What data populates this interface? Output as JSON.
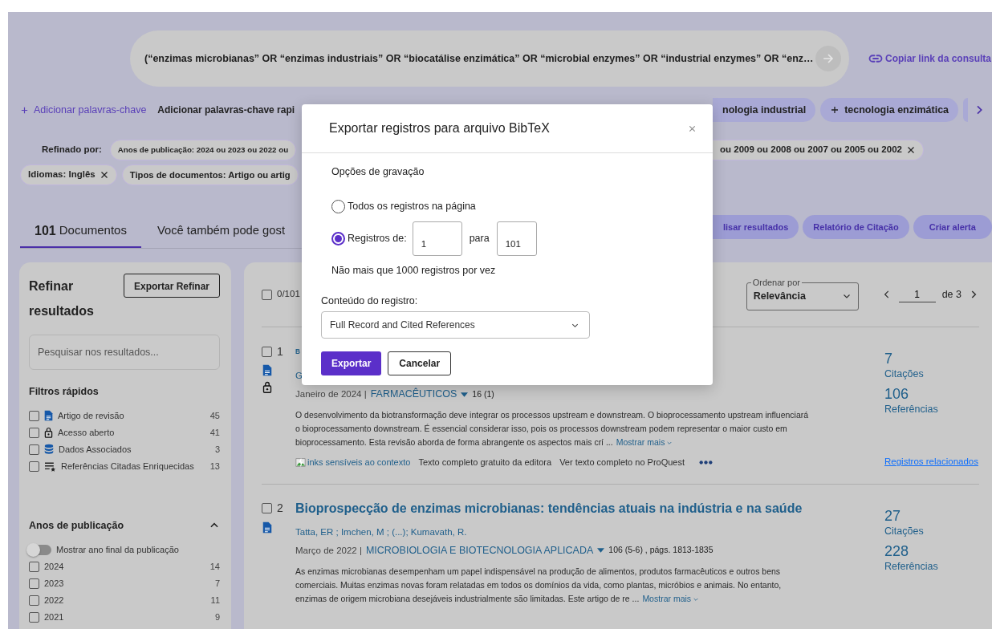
{
  "search": {
    "query": "(“enzimas microbianas” OR “enzimas industriais” OR “biocatálise enzimática” OR “microbial enzymes” OR “industrial enzymes” OR “enz…",
    "copy_link": "Copiar link da consulta"
  },
  "keywords": {
    "add": "Adicionar palavras-chave",
    "quick_label": "Adicionar palavras-chave rapi",
    "chips": [
      {
        "kind": "text",
        "label": "nologia industrial"
      },
      {
        "kind": "add",
        "label": "tecnologia enzimática"
      },
      {
        "kind": "stub"
      }
    ]
  },
  "refined_by": {
    "label": "Refinado por:",
    "rows": [
      {
        "left": [
          {
            "label": "Anos de publicação: 2024 ou 2023 ou 2022 ou",
            "removable": false
          }
        ],
        "right": [
          {
            "label": "ou 2009 ou 2008 ou 2007 ou 2005 ou 2002",
            "removable": true
          }
        ]
      },
      {
        "left": [
          {
            "label": "Idiomas: Inglês",
            "removable": true
          },
          {
            "label": "Tipos de documentos: Artigo ou artig",
            "removable": false
          }
        ]
      }
    ]
  },
  "tabs": [
    {
      "count": "101",
      "label": "Documentos",
      "selected": true
    },
    {
      "label": "Você também pode gost",
      "selected": false
    }
  ],
  "actions": [
    "lisar resultados",
    "Relatório de Citação",
    "Criar alerta"
  ],
  "refine": {
    "title": "Refinar resultados",
    "export": "Exportar Refinar",
    "search_placeholder": "Pesquisar nos resultados...",
    "quick_title": "Filtros rápidos",
    "quick_filters": [
      {
        "kind": "review",
        "label": "Artigo de revisão",
        "count": "45",
        "checked": false
      },
      {
        "kind": "open_access",
        "label": "Acesso aberto",
        "count": "41",
        "checked": false
      },
      {
        "kind": "data",
        "label": "Dados Associados",
        "count": "3",
        "checked": false
      },
      {
        "kind": "enriched",
        "label": "Referências Citadas Enriquecidas",
        "count": "13",
        "checked": false
      }
    ],
    "years_title": "Anos de publicação",
    "years_expanded": true,
    "toggle": {
      "label": "Mostrar ano final da publicação",
      "on": false
    },
    "years": [
      {
        "label": "2024",
        "count": "14",
        "checked": false
      },
      {
        "label": "2023",
        "count": "7",
        "checked": false
      },
      {
        "label": "2022",
        "count": "11",
        "checked": false
      },
      {
        "label": "2021",
        "count": "9",
        "checked": false
      }
    ]
  },
  "results": {
    "selected_count": "0/101",
    "all_checked": false,
    "sort": {
      "label": "Ordenar por",
      "value": "Relevância"
    },
    "page": {
      "current": "1",
      "of": "de 3"
    },
    "items": [
      {
        "number": "1",
        "checked": false,
        "title": "B",
        "open_access": true,
        "authors": "G",
        "date": "Janeiro de 2024 |",
        "journal": "FARMACÊUTICOS",
        "volume": "16 (1)",
        "abstract": "O desenvolvimento da biotransformação deve integrar os processos upstream e downstream. O bioprocessamento upstream influenciará o bioprocessamento downstream. É essencial considerar isso, pois os processos downstream podem representar o maior custo em bioprocessamento. Esta revisão aborda de forma abrangente os aspectos mais crí ...",
        "more": "Mostrar mais",
        "links": [
          {
            "kind": "broken_image",
            "label": "inks sensíveis ao contexto"
          },
          {
            "kind": "link",
            "label": "Texto completo gratuito da editora"
          },
          {
            "kind": "link",
            "label": "Ver texto completo no ProQuest"
          },
          {
            "kind": "more"
          }
        ],
        "citations": "7",
        "citations_label": "Citações",
        "references": "106",
        "references_label": "Referências",
        "related": "Registros relacionados"
      },
      {
        "number": "2",
        "checked": false,
        "title": "Bioprospecção de enzimas microbianas: tendências atuais na indústria e na saúde",
        "open_access": false,
        "authors": "Tatta, ER ; Imchen, M ; (...); Kumavath, R.",
        "date": "Março de 2022 |",
        "journal": "MICROBIOLOGIA E BIOTECNOLOGIA APLICADA",
        "volume": "106 (5-6) , págs. 1813-1835",
        "abstract": "As enzimas microbianas desempenham um papel indispensável na produção de alimentos, produtos farmacêuticos e outros bens comerciais. Muitas enzimas novas foram relatadas em todos os domínios da vida, como plantas, micróbios e animais. No entanto, enzimas de origem microbiana desejáveis industrialmente são limitadas. Este artigo de re ...",
        "more": "Mostrar mais",
        "citations": "27",
        "citations_label": "Citações",
        "references": "228",
        "references_label": "Referências"
      }
    ]
  },
  "modal": {
    "title": "Exportar registros para arquivo BibTeX",
    "section": "Opções de gravação",
    "options": [
      {
        "kind": "all",
        "label": "Todos os registros na página",
        "selected": false
      },
      {
        "kind": "range",
        "label": "Registros de:",
        "selected": true,
        "from": "1",
        "to_label": "para",
        "to": "101"
      }
    ],
    "note": "Não mais que 1000 registros por vez",
    "content_label": "Conteúdo do registro:",
    "content_value": "Full Record and Cited References",
    "buttons": [
      {
        "kind": "primary",
        "label": "Exportar"
      },
      {
        "kind": "secondary",
        "label": "Cancelar"
      }
    ]
  }
}
